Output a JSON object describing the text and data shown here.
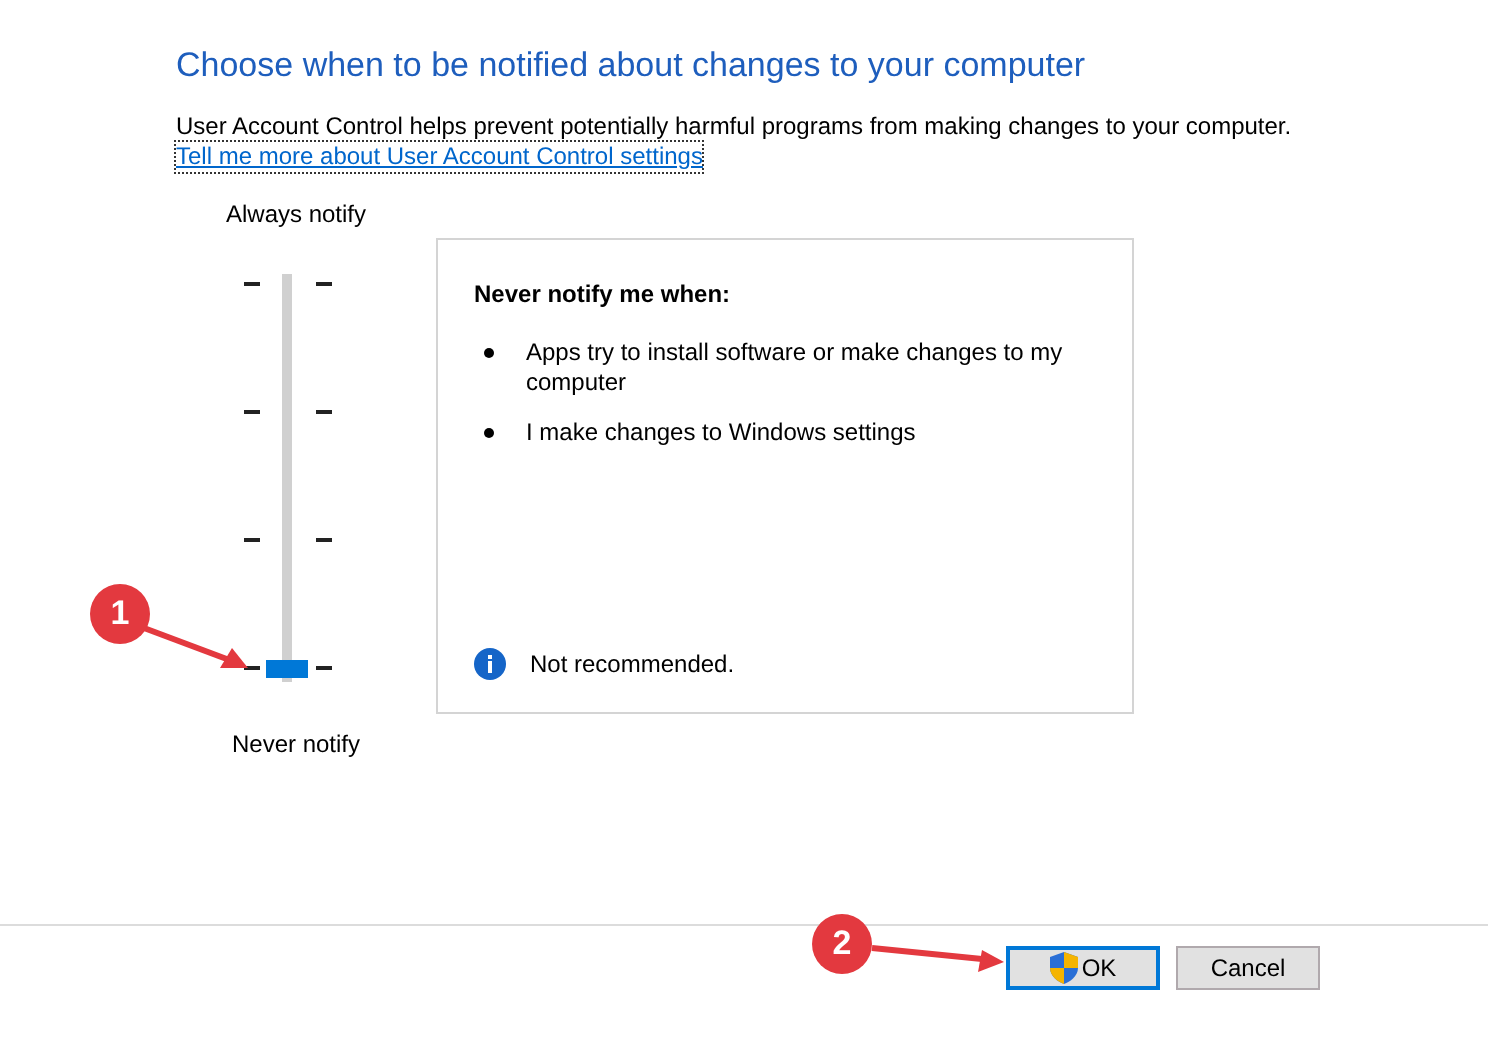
{
  "title": "Choose when to be notified about changes to your computer",
  "description": "User Account Control helps prevent potentially harmful programs from making changes to your computer.",
  "link": "Tell me more about User Account Control settings",
  "slider": {
    "top_label": "Always notify",
    "bottom_label": "Never notify",
    "level": 0
  },
  "panel": {
    "heading": "Never notify me when:",
    "items": [
      "Apps try to install software or make changes to my computer",
      "I make changes to Windows settings"
    ],
    "note": "Not recommended."
  },
  "buttons": [
    {
      "label": "OK",
      "default": true,
      "shield": true
    },
    {
      "label": "Cancel",
      "default": false,
      "shield": false
    }
  ],
  "annotations": [
    {
      "label": "1"
    },
    {
      "label": "2"
    }
  ]
}
